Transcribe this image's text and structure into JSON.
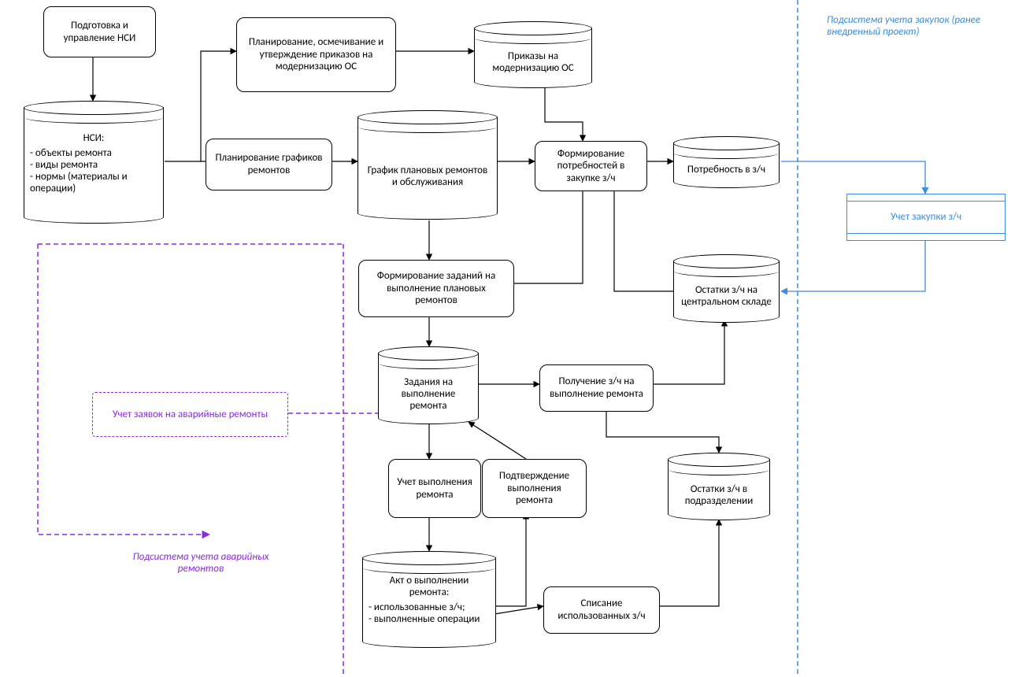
{
  "nodes": {
    "prep_nsi": "Подготовка и управление НСИ",
    "plan_modern": "Планирование, осмечивание и утверждение приказов на модернизацию ОС",
    "plan_graphs": "Планирование графиков ремонтов",
    "form_demand": "Формирование потребностей в закупке з/ч",
    "form_tasks": "Формирование заданий на выполнение плановых ремонтов",
    "recv_parts": "Получение з/ч на выполнение ремонта",
    "acct_exec": "Учет выполнения ремонта",
    "confirm_exec": "Подтверждение выполнения ремонта",
    "writeoff": "Списание использованных з/ч",
    "emergency": "Учет заявок на аварийные ремонты",
    "proc_parts": "Учет закупки з/ч"
  },
  "cyl": {
    "nsi_title": "НСИ:",
    "nsi_l1": "- объекты ремонта",
    "nsi_l2": "- виды ремонта",
    "nsi_l3": "- нормы (материалы и операции)",
    "orders": "Приказы на модернизацию ОС",
    "schedule": "График плановых ремонтов и обслуживания",
    "demand": "Потребность в з/ч",
    "central_stock": "Остатки з/ч на центральном складе",
    "tasks": "Задания на выполнение ремонта",
    "dept_stock": "Остатки з/ч в подразделении",
    "act_title": "Акт о выполнении ремонта:",
    "act_l1": "- использованные з/ч;",
    "act_l2": "- выполненные операции"
  },
  "captions": {
    "emergency_sub": "Подсистема учета аварийных ремонтов",
    "proc_sub": "Подсистема учета закупок (ранее внедренный проект)"
  },
  "colors": {
    "purple": "#8a2be2",
    "blue": "#3a8de0",
    "black": "#000000"
  }
}
